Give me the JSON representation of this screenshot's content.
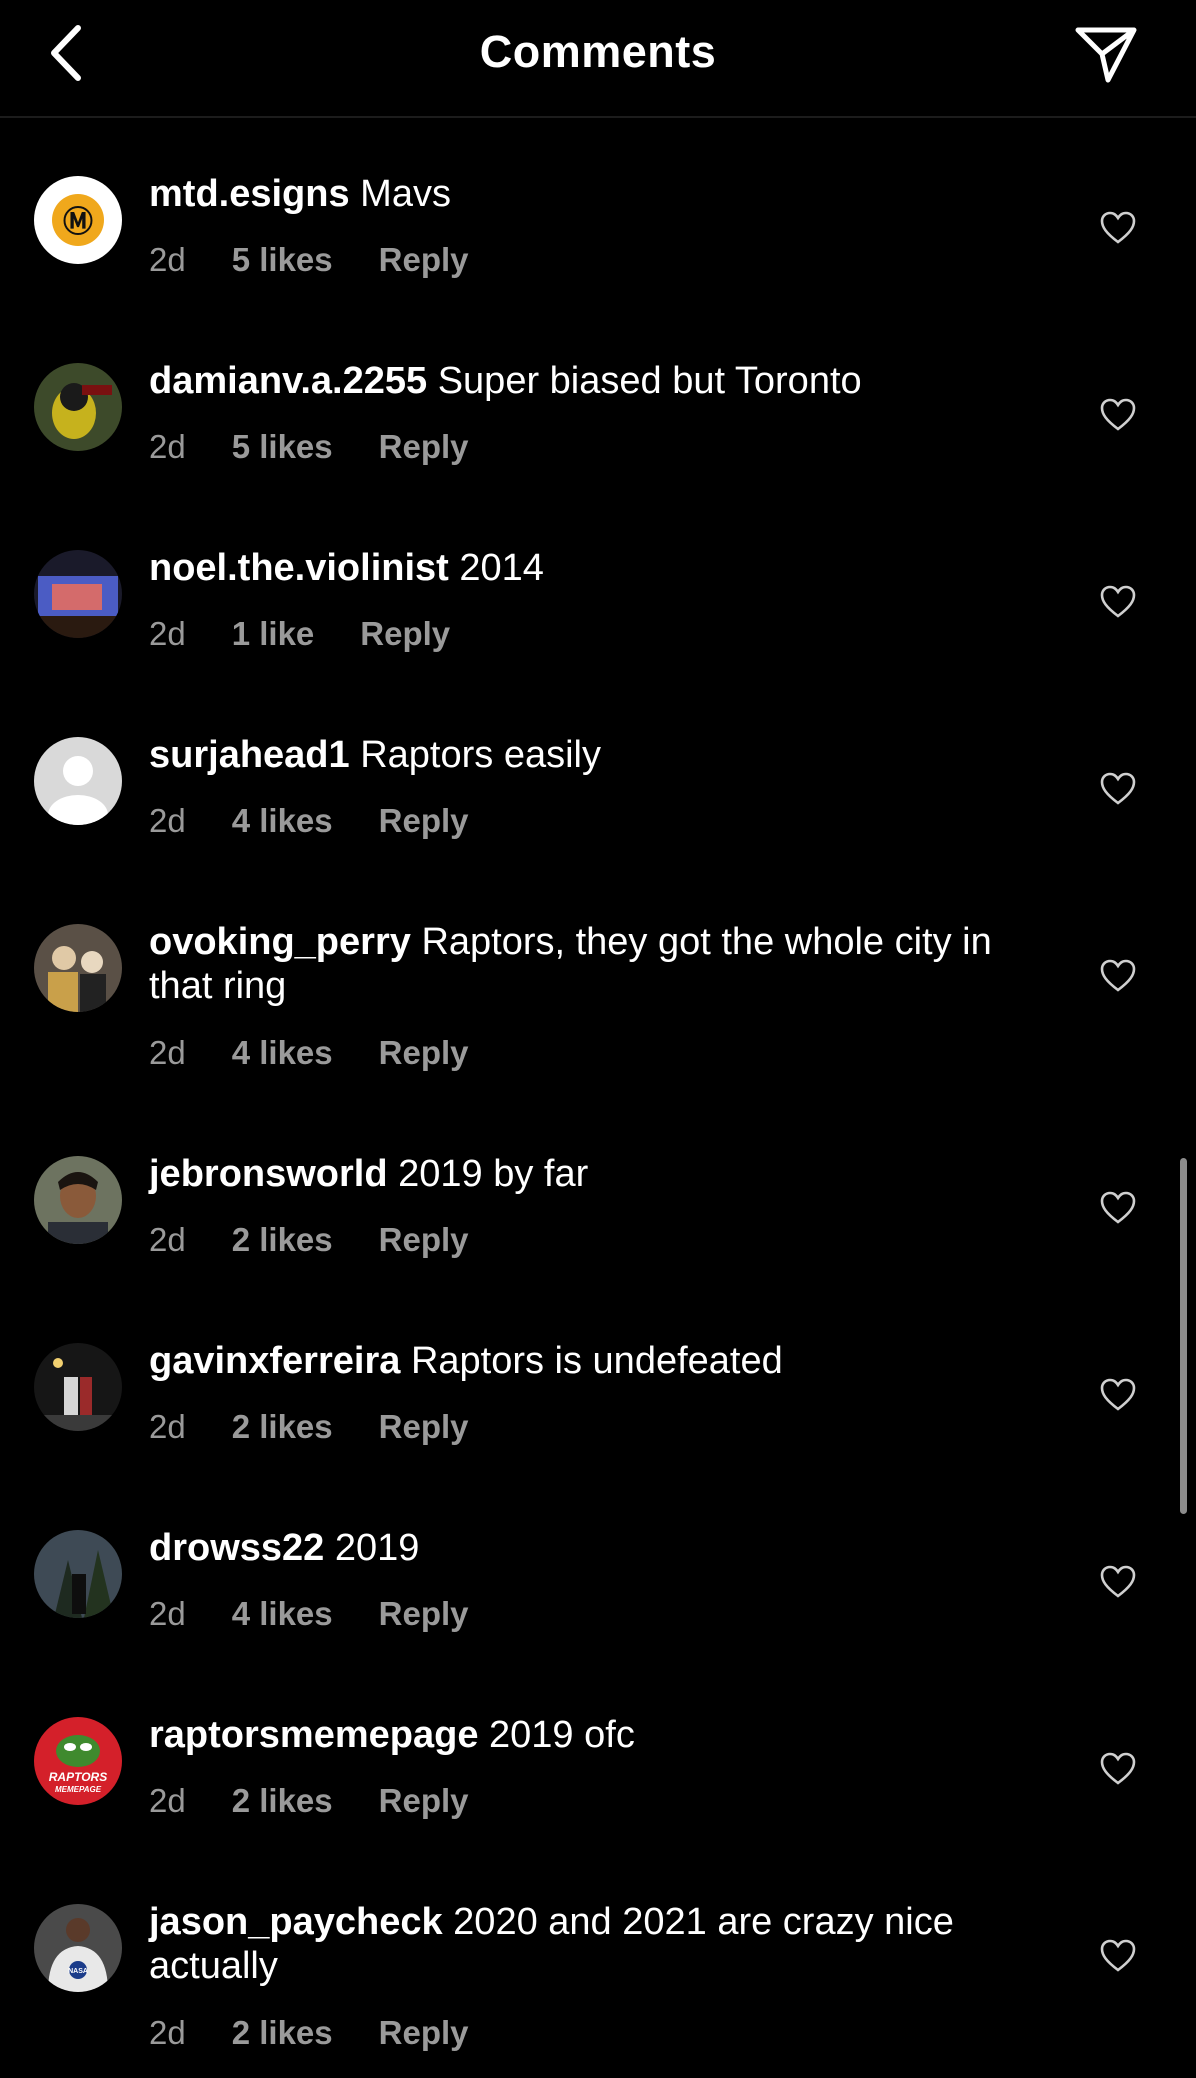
{
  "header": {
    "title": "Comments",
    "back_icon": "chevron-left-icon",
    "send_icon": "paper-plane-icon"
  },
  "comments": [
    {
      "user": "mtd.esigns",
      "text": "Mavs",
      "time": "2d",
      "likes": "5 likes",
      "reply": "Reply"
    },
    {
      "user": "damianv.a.2255",
      "text": "Super biased but Toronto",
      "time": "2d",
      "likes": "5 likes",
      "reply": "Reply"
    },
    {
      "user": "noel.the.violinist",
      "text": "2014",
      "time": "2d",
      "likes": "1 like",
      "reply": "Reply"
    },
    {
      "user": "surjahead1",
      "text": "Raptors easily",
      "time": "2d",
      "likes": "4 likes",
      "reply": "Reply"
    },
    {
      "user": "ovoking_perry",
      "text": "Raptors, they got the whole city in that ring",
      "time": "2d",
      "likes": "4 likes",
      "reply": "Reply"
    },
    {
      "user": "jebronsworld",
      "text": "2019 by far",
      "time": "2d",
      "likes": "2 likes",
      "reply": "Reply"
    },
    {
      "user": "gavinxferreira",
      "text": "Raptors is undefeated",
      "time": "2d",
      "likes": "2 likes",
      "reply": "Reply"
    },
    {
      "user": "drowss22",
      "text": "2019",
      "time": "2d",
      "likes": "4 likes",
      "reply": "Reply"
    },
    {
      "user": "raptorsmemepage",
      "text": "2019 ofc",
      "time": "2d",
      "likes": "2 likes",
      "reply": "Reply",
      "avatar_text": [
        "RAPTORS",
        "MEMEPAGE"
      ]
    },
    {
      "user": "jason_paycheck",
      "text": "2020 and 2021 are crazy nice actually",
      "time": "2d",
      "likes": "2 likes",
      "reply": "Reply",
      "avatar_text": [
        "NASA"
      ]
    }
  ],
  "colors": {
    "background": "#000000",
    "text": "#ffffff",
    "meta": "#9a9a9a",
    "divider": "#1c1c1c"
  }
}
